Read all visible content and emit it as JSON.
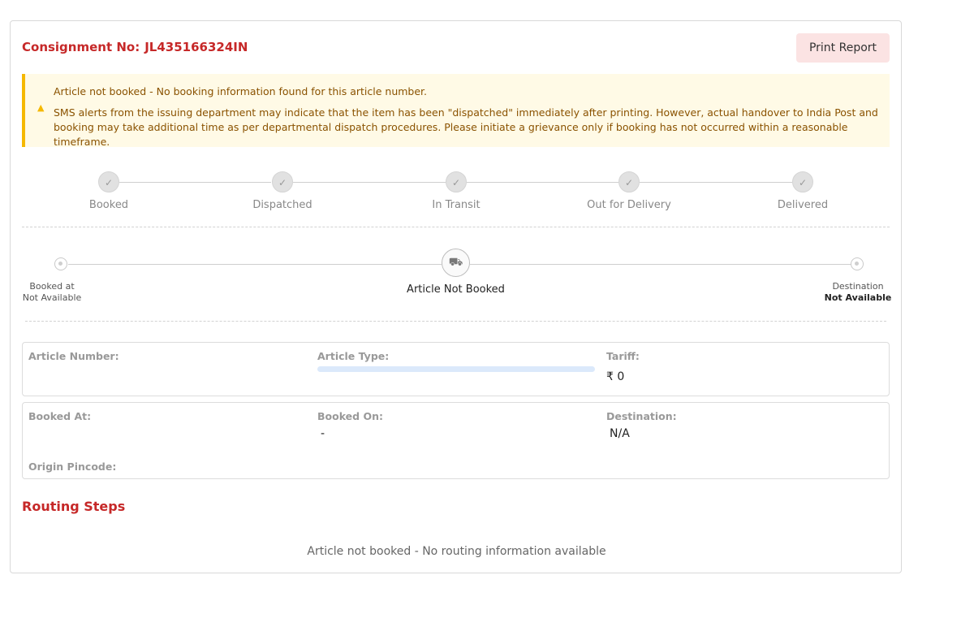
{
  "header": {
    "consignment_label": "Consignment No:",
    "consignment_number": "JL435166324IN",
    "print_label": "Print Report"
  },
  "alert": {
    "icon": "warning-icon",
    "title": "Article not booked - No booking information found for this article number.",
    "message": "SMS alerts from the issuing department may indicate that the item has been \"dispatched\" immediately after printing. However, actual handover to India Post and booking may take additional time as per departmental dispatch procedures. Please initiate a grievance only if booking has not occurred within a reasonable timeframe."
  },
  "stages": [
    {
      "label": "Booked",
      "icon": "check-icon"
    },
    {
      "label": "Dispatched",
      "icon": "check-icon"
    },
    {
      "label": "In Transit",
      "icon": "check-icon"
    },
    {
      "label": "Out for Delivery",
      "icon": "check-icon"
    },
    {
      "label": "Delivered",
      "icon": "check-icon"
    }
  ],
  "route": {
    "origin_label": "Booked at",
    "origin_value": "Not Available",
    "center_icon": "truck-icon",
    "center_label": "Article Not Booked",
    "destination_label": "Destination",
    "destination_value": "Not Available"
  },
  "details": {
    "article_number_label": "Article Number:",
    "article_number_value": "",
    "article_type_label": "Article Type:",
    "tariff_label": "Tariff:",
    "tariff_value": "₹ 0",
    "booked_at_label": "Booked At:",
    "booked_at_value": "",
    "booked_on_label": "Booked On:",
    "booked_on_value": "-",
    "destination_label": "Destination:",
    "destination_value": "N/A",
    "origin_pincode_label": "Origin Pincode:",
    "origin_pincode_value": ""
  },
  "routing": {
    "title": "Routing Steps",
    "empty_message": "Article not booked - No routing information available"
  },
  "colors": {
    "accent": "#c62828",
    "alert_bg": "#fffae6",
    "alert_border": "#f5b800",
    "print_bg": "#fbe3e3"
  }
}
